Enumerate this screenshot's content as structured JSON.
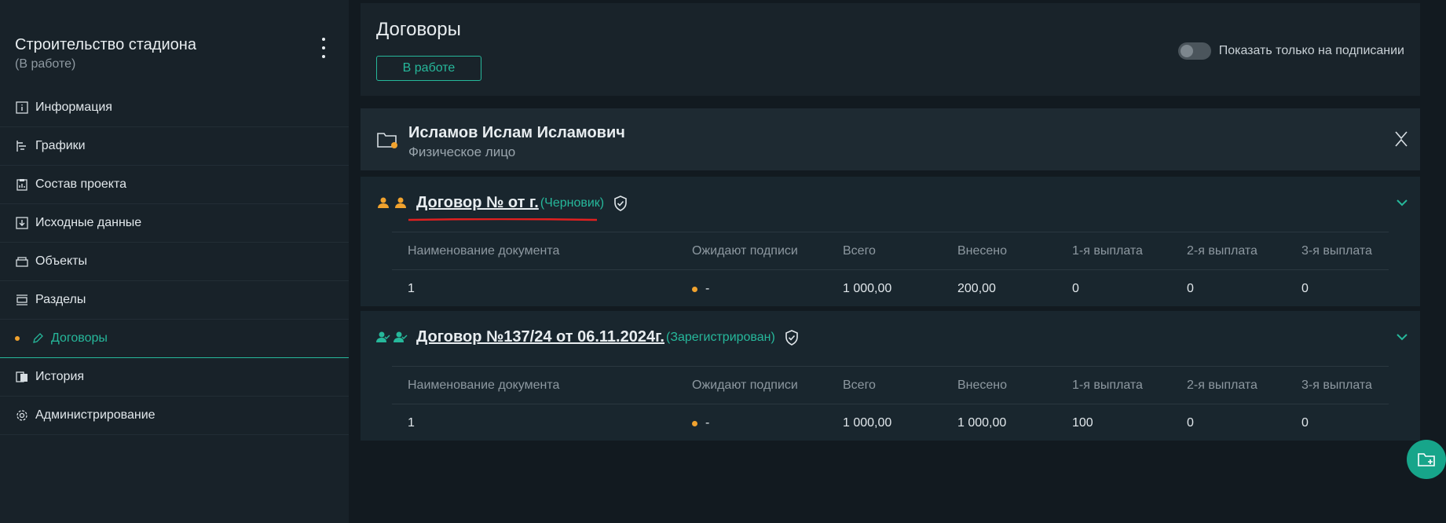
{
  "sidebar": {
    "project_title": "Строительство стадиона",
    "project_status": "(В работе)",
    "items": [
      {
        "label": "Информация",
        "icon": "info-icon"
      },
      {
        "label": "Графики",
        "icon": "chart-icon"
      },
      {
        "label": "Состав проекта",
        "icon": "clipboard-icon"
      },
      {
        "label": "Исходные данные",
        "icon": "download-icon"
      },
      {
        "label": "Объекты",
        "icon": "objects-icon"
      },
      {
        "label": "Разделы",
        "icon": "sections-icon"
      },
      {
        "label": "Договоры",
        "icon": "pen-icon",
        "active": true
      },
      {
        "label": "История",
        "icon": "history-icon"
      },
      {
        "label": "Администрирование",
        "icon": "gear-icon"
      }
    ]
  },
  "header": {
    "title": "Договоры",
    "status_button": "В работе",
    "toggle_label": "Показать только на подписании",
    "toggle_on": false
  },
  "person": {
    "name": "Исламов Ислам Исламович",
    "type": "Физическое лицо"
  },
  "table_headers": [
    "Наименование документа",
    "Ожидают подписи",
    "Всего",
    "Внесено",
    "1-я выплата",
    "2-я выплата",
    "3-я выплата"
  ],
  "contracts": [
    {
      "title": "Договор № от г.",
      "state": "(Черновик)",
      "row": {
        "name": "1",
        "awaiting": "-",
        "total": "1 000,00",
        "paid": "200,00",
        "p1": "0",
        "p2": "0",
        "p3": "0"
      }
    },
    {
      "title": "Договор №137/24 от 06.11.2024г.",
      "state": "(Зарегистрирован)",
      "row": {
        "name": "1",
        "awaiting": "-",
        "total": "1 000,00",
        "paid": "1 000,00",
        "p1": "100",
        "p2": "0",
        "p3": "0"
      }
    }
  ],
  "colors": {
    "accent": "#26b89b",
    "warning": "#f0a22e",
    "annotation": "#e02020"
  }
}
